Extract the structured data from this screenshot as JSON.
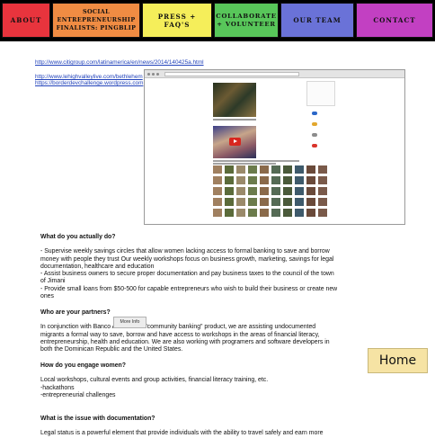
{
  "nav": {
    "items": [
      {
        "id": "about",
        "label": "About",
        "color": "#e8343d"
      },
      {
        "id": "social",
        "label": "Social\nentrepreneurship\nFinalists: PINGBLIP",
        "color": "#f08c43"
      },
      {
        "id": "press",
        "label": "Press +\nFAQ's",
        "color": "#f5ee5a"
      },
      {
        "id": "collab",
        "label": "Collaborate\n+ Volunteer",
        "color": "#58c65a"
      },
      {
        "id": "team",
        "label": "Our Team",
        "color": "#6a72d8"
      },
      {
        "id": "contact",
        "label": "Contact",
        "color": "#c240c2"
      }
    ]
  },
  "links": {
    "citigroup": "http://www.citigroup.com/latinamerica/en/news/2014/140425a.html",
    "lehigh": "http://www.lehighvalleylive.com/bethlehem",
    "borderdev": "https://borderdevchallenge.wordpress.com"
  },
  "sections": {
    "q1": "What do you actually do?",
    "a1_lines": [
      "- Supervise weekly savings circles that allow women lacking access to formal banking to save and borrow",
      "money with people they trust Our weekly workshops focus on business growth, marketing, savings for legal",
      "documentation, healthcare and education",
      "- Assist business owners to secure proper documentation and pay business taxes to the council of the town",
      "of Jimani",
      "- Provide small loans from $50-500 for capable entrepreneurs who wish to build their business or create new",
      "ones"
    ],
    "q2": "Who are your partners?",
    "a2_lines": [
      "In conjunction with Banco ADOPEM's \"community banking\" product, we are assisting undocumented",
      "migrants a formal way to save, borrow and have access to workshops in the areas of financial literacy,",
      "entrepreneurship, health and education. We are also working with programers and software developers in",
      "both the Dominican Republic and the United States."
    ],
    "q3": "How do you engage women?",
    "a3_lines": [
      "Local workshops, cultural events and group activities, financial literacy training, etc.",
      "-hackathons",
      "-entrepreneurial challenges"
    ],
    "q4": "What is the issue with documentation?",
    "a4_lines": [
      "Legal status is a powerful element that provide individuals with the ability to travel safely and earn more"
    ]
  },
  "buttons": {
    "more_info": "More Info",
    "home": "Home"
  },
  "colors": {
    "link": "#2243bb",
    "home_bg": "#f6e3a4",
    "nav_bg": "#000000"
  }
}
